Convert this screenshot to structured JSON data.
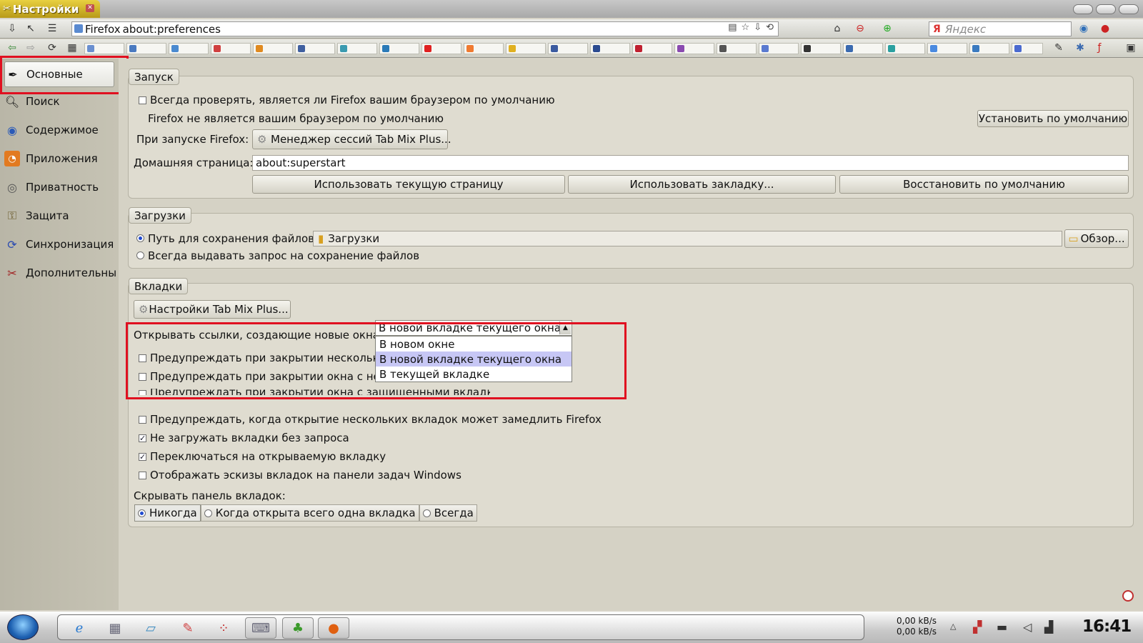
{
  "window": {
    "title": "Настройки"
  },
  "navbar": {
    "site_label": "Firefox",
    "url": "about:preferences",
    "search_placeholder": "Яндекс"
  },
  "sidebar": {
    "items": [
      {
        "label": "Основные",
        "icon": "general-icon"
      },
      {
        "label": "Поиск",
        "icon": "search-icon"
      },
      {
        "label": "Содержимое",
        "icon": "content-globe-icon"
      },
      {
        "label": "Приложения",
        "icon": "rss-feed-icon"
      },
      {
        "label": "Приватность",
        "icon": "mask-icon"
      },
      {
        "label": "Защита",
        "icon": "padlock-icon"
      },
      {
        "label": "Синхронизация",
        "icon": "sync-icon"
      },
      {
        "label": "Дополнительны",
        "icon": "tools-icon"
      }
    ],
    "selected": "Основные"
  },
  "startup": {
    "caption": "Запуск",
    "always_check": "Всегда проверять, является ли Firefox вашим браузером по умолчанию",
    "always_check_checked": false,
    "not_default": "Firefox не является вашим браузером по умолчанию",
    "set_default_button": "Установить по умолчанию",
    "on_start_label": "При запуске Firefox:",
    "on_start_value": "Менеджер сессий Tab Mix Plus...",
    "home_label": "Домашняя страница:",
    "home_value": "about:superstart",
    "use_current_button": "Использовать текущую страницу",
    "use_bookmark_button": "Использовать закладку...",
    "restore_default_button": "Восстановить по умолчанию"
  },
  "downloads": {
    "caption": "Загрузки",
    "save_path_label": "Путь для сохранения файлов",
    "save_path_value": "Загрузки",
    "browse_button": "Обзор...",
    "always_ask_label": "Всегда выдавать запрос на сохранение файлов",
    "selected_option": "save_path"
  },
  "tabs": {
    "caption": "Вкладки",
    "tmp_settings_button": "Настройки Tab Mix Plus...",
    "open_links_label": "Открывать ссылки, создающие новые окна:",
    "open_links_selected": "В новой вкладке текущего окна",
    "open_links_options": [
      "В новом окне",
      "В новой вкладке текущего окна",
      "В текущей вкладке"
    ],
    "warn_close_multiple": "Предупреждать при закрытии нескольких",
    "warn_close_window": "Предупреждать при закрытии окна с неск",
    "warn_close_protected": "Предупреждать при закрытии окна с защищёнными вкладками",
    "warn_slow": "Предупреждать, когда открытие нескольких вкладок может замедлить Firefox",
    "warn_slow_checked": false,
    "dont_load": "Не загружать вкладки без запроса",
    "dont_load_checked": true,
    "switch_to_new": "Переключаться на открываемую вкладку",
    "switch_to_new_checked": true,
    "show_previews": "Отображать эскизы вкладок на панели задач Windows",
    "show_previews_checked": false,
    "hide_bar_label": "Скрывать панель вкладок:",
    "hide_bar_options": [
      "Никогда",
      "Когда открыта всего одна вкладка",
      "Всегда"
    ],
    "hide_bar_selected": "Никогда"
  },
  "taskbar": {
    "net_down": "0,00 kB/s",
    "net_up": "0,00 kB/s",
    "clock": "16:41"
  },
  "colors": {
    "highlight_red": "#e01020",
    "dropdown_selection": "#c7c7f5",
    "title_tab_gold": "#d8b828"
  }
}
